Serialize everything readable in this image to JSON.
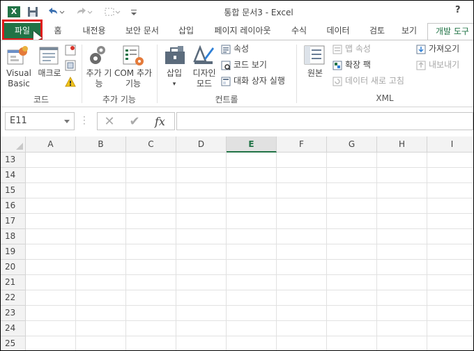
{
  "window": {
    "title": "통합 문서3 - Excel",
    "help": "?",
    "logo": "X",
    "icons": [
      "excel-logo-icon",
      "save-icon",
      "undo-icon",
      "redo-icon",
      "customize-qat-icon"
    ]
  },
  "tabs": [
    {
      "label": "파일"
    },
    {
      "label": "홈"
    },
    {
      "label": "내전용"
    },
    {
      "label": "보안 문서"
    },
    {
      "label": "삽입"
    },
    {
      "label": "페이지 레이아웃"
    },
    {
      "label": "수식"
    },
    {
      "label": "데이터"
    },
    {
      "label": "검토"
    },
    {
      "label": "보기"
    },
    {
      "label": "개발 도구"
    }
  ],
  "ribbon": {
    "code": {
      "group_label": "코드",
      "visual_basic": "Visual Basic",
      "macro": "매크로"
    },
    "addins": {
      "group_label": "추가 기능",
      "addins_btn": "추가 기능",
      "com_btn": "COM 추가 기능"
    },
    "controls": {
      "group_label": "컨트롤",
      "insert": "삽입",
      "design_mode": "디자인 모드",
      "properties": "속성",
      "view_code": "코드 보기",
      "run_dialog": "대화 상자 실행"
    },
    "xml": {
      "group_label": "XML",
      "source": "원본",
      "map_properties": "맵 속성",
      "expansion_packs": "확장 팩",
      "refresh_data": "데이터 새로 고침",
      "import": "가져오기",
      "export": "내보내기"
    }
  },
  "formula_bar": {
    "name_box": "E11",
    "cancel": "✕",
    "enter": "✔",
    "fx": "fx",
    "value": ""
  },
  "sheet": {
    "columns": [
      "A",
      "B",
      "C",
      "D",
      "E",
      "F",
      "G",
      "H",
      "I"
    ],
    "selected_column": "E",
    "rows": [
      "13",
      "14",
      "15",
      "16",
      "17",
      "18",
      "19",
      "20",
      "21",
      "22",
      "23",
      "24",
      "25"
    ]
  },
  "colors": {
    "accent": "#217346",
    "highlight": "#e01b1b"
  }
}
